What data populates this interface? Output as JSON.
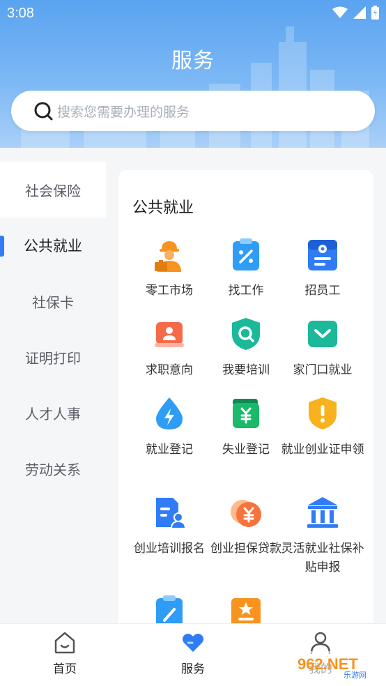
{
  "status": {
    "time": "3:08"
  },
  "header": {
    "title": "服务"
  },
  "search": {
    "placeholder": "搜索您需要办理的服务"
  },
  "sidebar": {
    "items": [
      {
        "label": "社会保险"
      },
      {
        "label": "公共就业"
      },
      {
        "label": "社保卡"
      },
      {
        "label": "证明打印"
      },
      {
        "label": "人才人事"
      },
      {
        "label": "劳动关系"
      }
    ]
  },
  "panel": {
    "title": "公共就业",
    "items": [
      {
        "label": "零工市场",
        "icon": "worker-icon"
      },
      {
        "label": "找工作",
        "icon": "clipboard-percent-icon"
      },
      {
        "label": "招员工",
        "icon": "badge-icon"
      },
      {
        "label": "求职意向",
        "icon": "resume-card-icon"
      },
      {
        "label": "我要培训",
        "icon": "shield-search-icon"
      },
      {
        "label": "家门口就业",
        "icon": "home-mail-icon"
      },
      {
        "label": "就业登记",
        "icon": "droplet-bolt-icon"
      },
      {
        "label": "失业登记",
        "icon": "wallet-yuan-icon"
      },
      {
        "label": "就业创业证申领",
        "icon": "shield-alert-icon"
      },
      {
        "label": "创业培训报名",
        "icon": "doc-person-icon"
      },
      {
        "label": "创业担保贷款",
        "icon": "coins-yuan-icon"
      },
      {
        "label": "灵活就业社保补贴申报",
        "icon": "bank-icon"
      },
      {
        "label": "",
        "icon": "clipboard-pen-icon"
      },
      {
        "label": "",
        "icon": "star-doc-icon"
      }
    ]
  },
  "tabbar": {
    "items": [
      {
        "label": "首页",
        "icon": "home-icon"
      },
      {
        "label": "服务",
        "icon": "heart-service-icon"
      },
      {
        "label": "我的",
        "icon": "person-icon"
      }
    ]
  },
  "watermark": {
    "text": "962.NET",
    "sub": "乐游网"
  },
  "colors": {
    "accent": "#2f7cf6",
    "orange": "#f7931e",
    "teal": "#1bb99a",
    "headerTop": "#5aa3f0"
  }
}
